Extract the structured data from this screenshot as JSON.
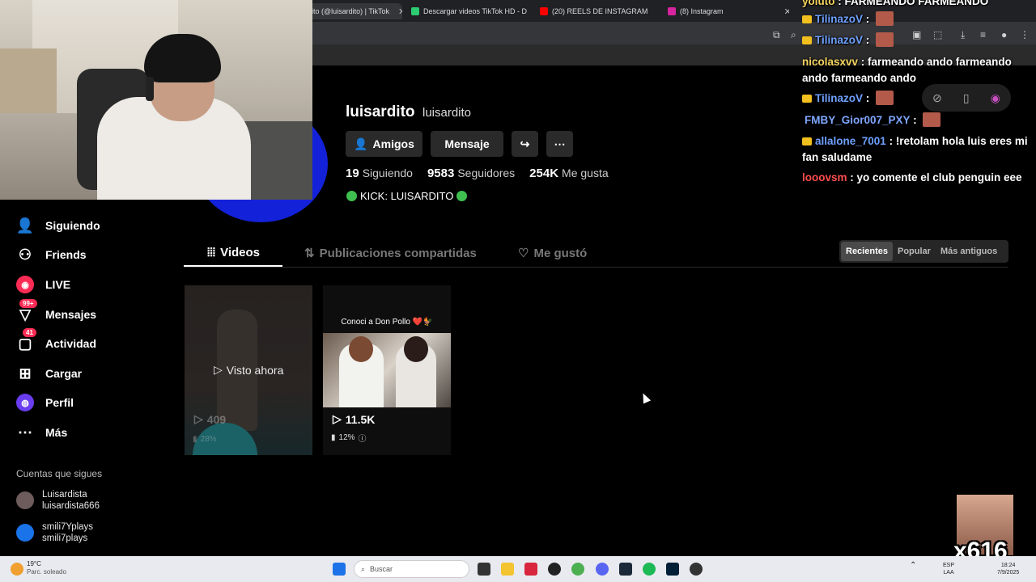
{
  "browser": {
    "tabs": [
      {
        "title": "dito (@luisardito) | TikTok",
        "favicon_color": "#111111"
      },
      {
        "title": "Descargar videos TikTok HD - D",
        "favicon_color": "#2ecc71"
      },
      {
        "title": "(20) REELS DE INSTAGRAM",
        "favicon_color": "#ff0000"
      },
      {
        "title": "(8) Instagram",
        "favicon_color": "#d6249f"
      }
    ]
  },
  "sidebar": {
    "items": [
      {
        "label": "Siguiendo",
        "icon": "following-icon"
      },
      {
        "label": "Friends",
        "icon": "friends-icon"
      },
      {
        "label": "LIVE",
        "icon": "live-icon"
      },
      {
        "label": "Mensajes",
        "icon": "messages-icon",
        "badge": "99+"
      },
      {
        "label": "Actividad",
        "icon": "activity-icon",
        "badge": "41"
      },
      {
        "label": "Cargar",
        "icon": "upload-icon"
      },
      {
        "label": "Perfil",
        "icon": "profile-icon"
      },
      {
        "label": "Más",
        "icon": "more-icon"
      }
    ],
    "following_title": "Cuentas que sigues",
    "following": [
      {
        "name": "Luisardista",
        "handle": "luisardista666"
      },
      {
        "name": "smili7Yplays",
        "handle": "smili7plays"
      }
    ]
  },
  "profile": {
    "username": "luisardito",
    "nickname": "luisardito",
    "buttons": {
      "friends": "Amigos",
      "message": "Mensaje"
    },
    "stats": [
      {
        "value": "19",
        "label": "Siguiendo"
      },
      {
        "value": "9583",
        "label": "Seguidores"
      },
      {
        "value": "254K",
        "label": "Me gusta"
      }
    ],
    "bio": "KICK: LUISARDITO"
  },
  "tabs": {
    "videos": "Videos",
    "reposts": "Publicaciones compartidas",
    "liked": "Me gustó"
  },
  "sort": [
    "Recientes",
    "Popular",
    "Más antiguos"
  ],
  "videos": [
    {
      "overlay": "Visto ahora",
      "plays": "409",
      "pct": "28%"
    },
    {
      "caption": "Conoci a Don Pollo ❤️🐓",
      "plays": "11.5K",
      "pct": "12%"
    }
  ],
  "chat": [
    {
      "user": "yoluto",
      "msg": "FARMEANDO FARMEANDO",
      "color": "#f4d35e"
    },
    {
      "user": "TilinazoV",
      "msg": "",
      "color": "#6ea0ff"
    },
    {
      "user": "TilinazoV",
      "msg": "",
      "color": "#6ea0ff"
    },
    {
      "user": "nicolasxvv",
      "msg": "farmeando ando farmeando ando farmeando ando",
      "color": "#f4d35e"
    },
    {
      "user": "TilinazoV",
      "msg": "",
      "color": "#6ea0ff"
    },
    {
      "user": "FMBY_Gior007_PXY",
      "msg": "",
      "color": "#7fa7ff"
    },
    {
      "user": "allalone_7001",
      "msg": "!retolam hola luis eres mi fan saludame",
      "color": "#6ea0ff"
    },
    {
      "user": "looovsm",
      "msg": "yo comente el club penguin eee",
      "color": "#ff4d4d"
    }
  ],
  "sticker_text": "x616",
  "taskbar": {
    "weather_temp": "19°C",
    "weather_desc": "Parc. soleado",
    "search_placeholder": "Buscar",
    "lang": "ESP",
    "lang2": "LAA",
    "time": "18:24",
    "date": "7/9/2025"
  }
}
